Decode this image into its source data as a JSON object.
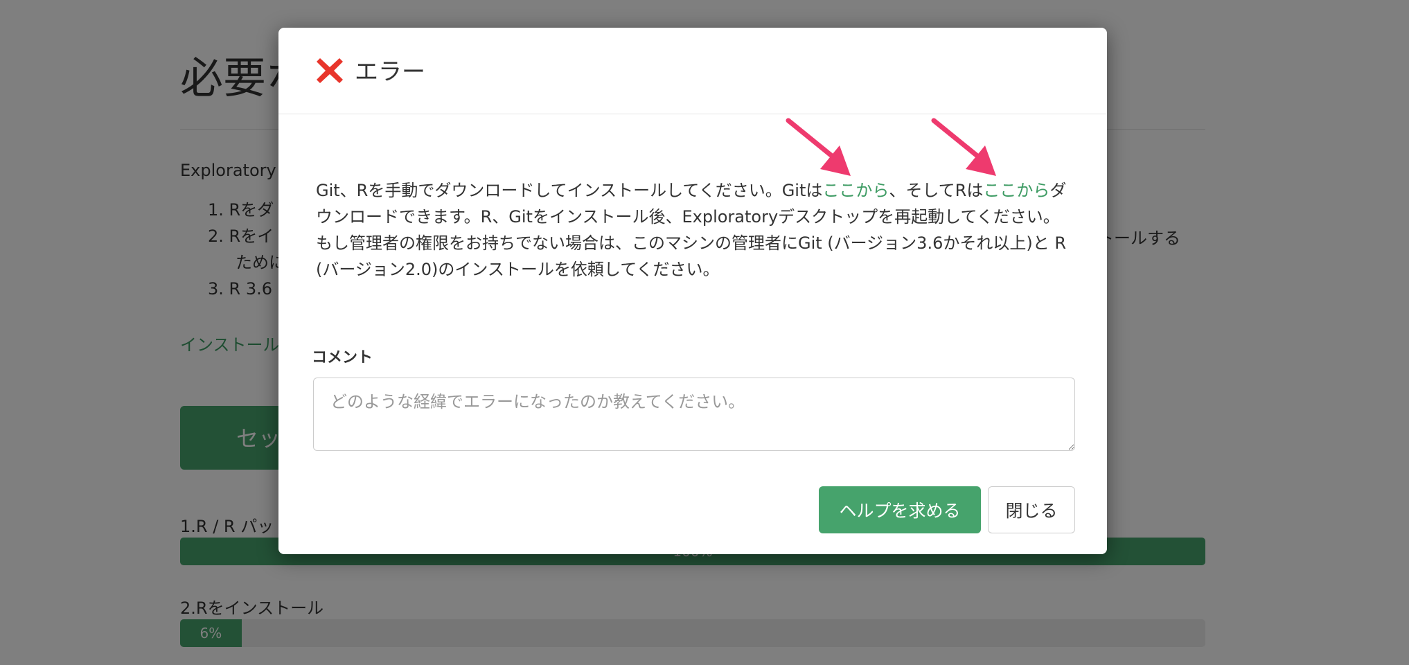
{
  "background": {
    "title": "必要な",
    "intro": "Exploratory",
    "list": [
      "1. Rをダ",
      "2. Rをイ",
      "ために",
      "3. R 3.6"
    ],
    "list_tail": "ストールする",
    "install_link": "インストール",
    "setup_button": "セットア",
    "steps": [
      {
        "label": "1.R / R パッ",
        "progress_text": "100%",
        "progress": 100
      },
      {
        "label": "2.Rをインストール",
        "progress_text": "6%",
        "progress": 6
      }
    ]
  },
  "modal": {
    "title": "エラー",
    "message": {
      "part1": "Git、Rを手動でダウンロードしてインストールしてください。Gitは",
      "link1": "ここから",
      "part2": "、そしてRは",
      "link2": "ここから",
      "part3": "ダウンロードできます。R、Gitをインストール後、Exploratoryデスクトップを再起動してください。もし管理者の権限をお持ちでない場合は、このマシンの管理者にGit (バージョン3.6かそれ以上)と R (バージョン2.0)のインストールを依頼してください。"
    },
    "comment_label": "コメント",
    "comment_placeholder": "どのような経緯でエラーになったのか教えてください。",
    "help_button": "ヘルプを求める",
    "close_button": "閉じる"
  },
  "colors": {
    "accent_green": "#46a36c",
    "error_red": "#e8352b",
    "annotation_pink": "#ee3a6e"
  },
  "icons": {
    "error": "x-mark-icon",
    "annotation": "arrow-icon"
  }
}
